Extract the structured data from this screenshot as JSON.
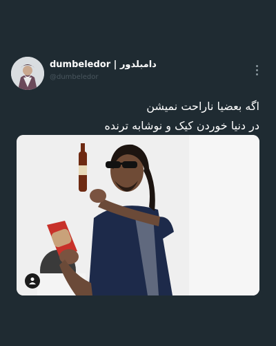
{
  "post": {
    "display_name": "dumbeledor | دامبلدور",
    "handle": "@dumbeledor",
    "text_lines": [
      "اگه بعضیا ناراحت نمیشن",
      "در دنیا خوردن کیک و نوشابه ترنده"
    ],
    "more_icon": "more-vertical-icon",
    "media_badge_icon": "person-icon"
  },
  "colors": {
    "background": "#1f2b32",
    "text": "#ffffff",
    "muted": "#6c7a83"
  }
}
